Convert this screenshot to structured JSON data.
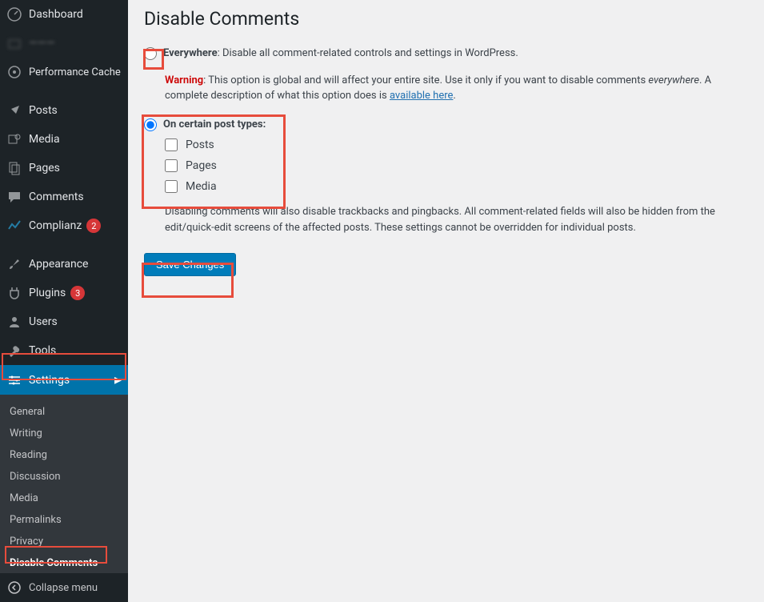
{
  "sidebar": {
    "dashboard": "Dashboard",
    "blurred": "…",
    "perf_cache": "Performance Cache",
    "posts": "Posts",
    "media": "Media",
    "pages": "Pages",
    "comments": "Comments",
    "complianz": "Complianz",
    "complianz_count": "2",
    "appearance": "Appearance",
    "plugins": "Plugins",
    "plugins_count": "3",
    "users": "Users",
    "tools": "Tools",
    "settings": "Settings",
    "submenu": {
      "general": "General",
      "writing": "Writing",
      "reading": "Reading",
      "discussion": "Discussion",
      "media": "Media",
      "permalinks": "Permalinks",
      "privacy": "Privacy",
      "disable_comments": "Disable Comments"
    },
    "collapse": "Collapse menu"
  },
  "page": {
    "title": "Disable Comments",
    "everywhere_label": "Everywhere",
    "everywhere_desc": ": Disable all comment-related controls and settings in WordPress.",
    "warning_label": "Warning",
    "warning_text": ": This option is global and will affect your entire site. Use it only if you want to disable comments ",
    "warning_em": "everywhere",
    "warning_tail": ". A complete description of what this option does is ",
    "warning_link": "available here",
    "on_types_label": "On certain post types:",
    "cb_posts": "Posts",
    "cb_pages": "Pages",
    "cb_media": "Media",
    "note": "Disabling comments will also disable trackbacks and pingbacks. All comment-related fields will also be hidden from the edit/quick-edit screens of the affected posts. These settings cannot be overridden for individual posts.",
    "save": "Save Changes"
  }
}
